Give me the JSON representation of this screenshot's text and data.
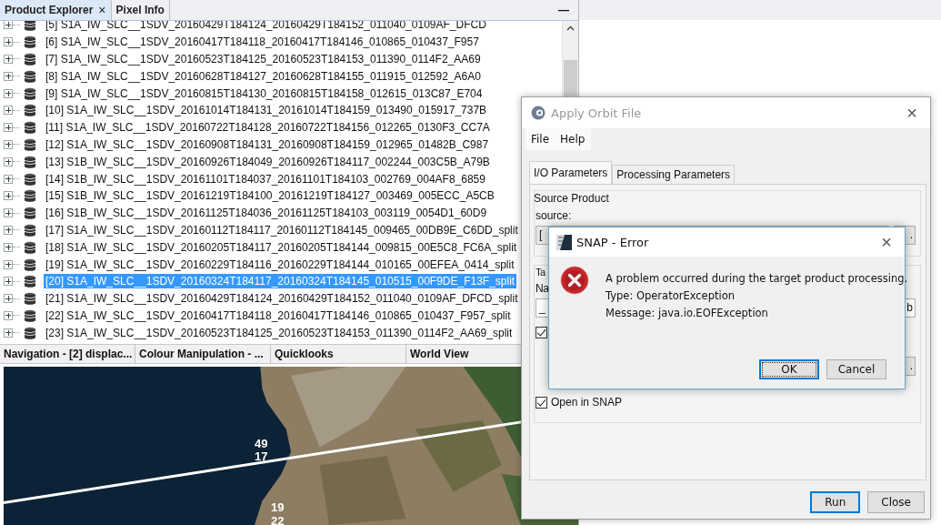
{
  "left_panel": {
    "tabs": [
      {
        "label": "Product Explorer",
        "selected": true,
        "close": "×"
      },
      {
        "label": "Pixel Info",
        "selected": false
      }
    ],
    "minimize": "—",
    "tree": [
      {
        "label": "[5] S1A_IW_SLC__1SDV_20160429T184124_20160429T184152_011040_0109AF_DFCD",
        "selected": false,
        "expanded": false
      },
      {
        "label": "[6] S1A_IW_SLC__1SDV_20160417T184118_20160417T184146_010865_010437_F957",
        "selected": false,
        "expanded": false
      },
      {
        "label": "[7] S1A_IW_SLC__1SDV_20160523T184125_20160523T184153_011390_0114F2_AA69",
        "selected": false,
        "expanded": false
      },
      {
        "label": "[8] S1A_IW_SLC__1SDV_20160628T184127_20160628T184155_011915_012592_A6A0",
        "selected": false,
        "expanded": false
      },
      {
        "label": "[9] S1A_IW_SLC__1SDV_20160815T184130_20160815T184158_012615_013C87_E704",
        "selected": false,
        "expanded": false
      },
      {
        "label": "[10] S1A_IW_SLC__1SDV_20161014T184131_20161014T184159_013490_015917_737B",
        "selected": false,
        "expanded": false
      },
      {
        "label": "[11] S1A_IW_SLC__1SDV_20160722T184128_20160722T184156_012265_0130F3_CC7A",
        "selected": false,
        "expanded": false
      },
      {
        "label": "[12] S1A_IW_SLC__1SDV_20160908T184131_20160908T184159_012965_01482B_C987",
        "selected": false,
        "expanded": false
      },
      {
        "label": "[13] S1B_IW_SLC__1SDV_20160926T184049_20160926T184117_002244_003C5B_A79B",
        "selected": false,
        "expanded": false
      },
      {
        "label": "[14] S1B_IW_SLC__1SDV_20161101T184037_20161101T184103_002769_004AF8_6859",
        "selected": false,
        "expanded": false
      },
      {
        "label": "[15] S1B_IW_SLC__1SDV_20161219T184100_20161219T184127_003469_005ECC_A5CB",
        "selected": false,
        "expanded": false
      },
      {
        "label": "[16] S1B_IW_SLC__1SDV_20161125T184036_20161125T184103_003119_0054D1_60D9",
        "selected": false,
        "expanded": false
      },
      {
        "label": "[17] S1A_IW_SLC__1SDV_20160112T184117_20160112T184145_009465_00DB9E_C6DD_split",
        "selected": false,
        "expanded": false
      },
      {
        "label": "[18] S1A_IW_SLC__1SDV_20160205T184117_20160205T184144_009815_00E5C8_FC6A_split",
        "selected": false,
        "expanded": false
      },
      {
        "label": "[19] S1A_IW_SLC__1SDV_20160229T184116_20160229T184144_010165_00EFEA_0414_split",
        "selected": false,
        "expanded": false
      },
      {
        "label": "[20] S1A_IW_SLC__1SDV_20160324T184117_20160324T184145_010515_00F9DE_F13F_split",
        "selected": true,
        "expanded": false
      },
      {
        "label": "[21] S1A_IW_SLC__1SDV_20160429T184124_20160429T184152_011040_0109AF_DFCD_split",
        "selected": false,
        "expanded": false
      },
      {
        "label": "[22] S1A_IW_SLC__1SDV_20160417T184118_20160417T184146_010865_010437_F957_split",
        "selected": false,
        "expanded": false
      },
      {
        "label": "[23] S1A_IW_SLC__1SDV_20160523T184125_20160523T184153_011390_0114F2_AA69_split",
        "selected": false,
        "expanded": false
      }
    ],
    "bottom_tabs": [
      {
        "label": "Navigation - [2] displac...",
        "selected": false
      },
      {
        "label": "Colour Manipulation - ...",
        "selected": false
      },
      {
        "label": "Quicklooks",
        "selected": false
      },
      {
        "label": "World View",
        "selected": false
      }
    ],
    "map": {
      "kind": "picture",
      "labels": [
        "49",
        "17",
        "19",
        "22"
      ]
    }
  },
  "apply_dialog": {
    "title": "Apply Orbit File",
    "close": "×",
    "menu": [
      "File",
      "Help"
    ],
    "tabs": [
      {
        "label": "I/O Parameters",
        "selected": true
      },
      {
        "label": "Processing Parameters",
        "selected": false
      }
    ],
    "source_group": {
      "title": "Source Product",
      "label": "source:",
      "value": "[",
      "browse": "."
    },
    "target_group": {
      "title": "Ta",
      "name_label": "Na",
      "name_value": "_",
      "field_end": "b",
      "save_checked": true,
      "dir_browse": ".",
      "open_in_snap": {
        "label": "Open in SNAP",
        "checked": true
      }
    },
    "buttons": [
      {
        "label": "Run",
        "focused": true
      },
      {
        "label": "Close",
        "focused": false
      }
    ]
  },
  "error_dialog": {
    "title": "SNAP - Error",
    "close": "×",
    "lines": [
      "A problem occurred during the target product processing.",
      "Type: OperatorException",
      "Message: java.io.EOFException"
    ],
    "buttons": [
      {
        "label": "OK",
        "focused": true
      },
      {
        "label": "Cancel",
        "focused": false
      }
    ]
  }
}
